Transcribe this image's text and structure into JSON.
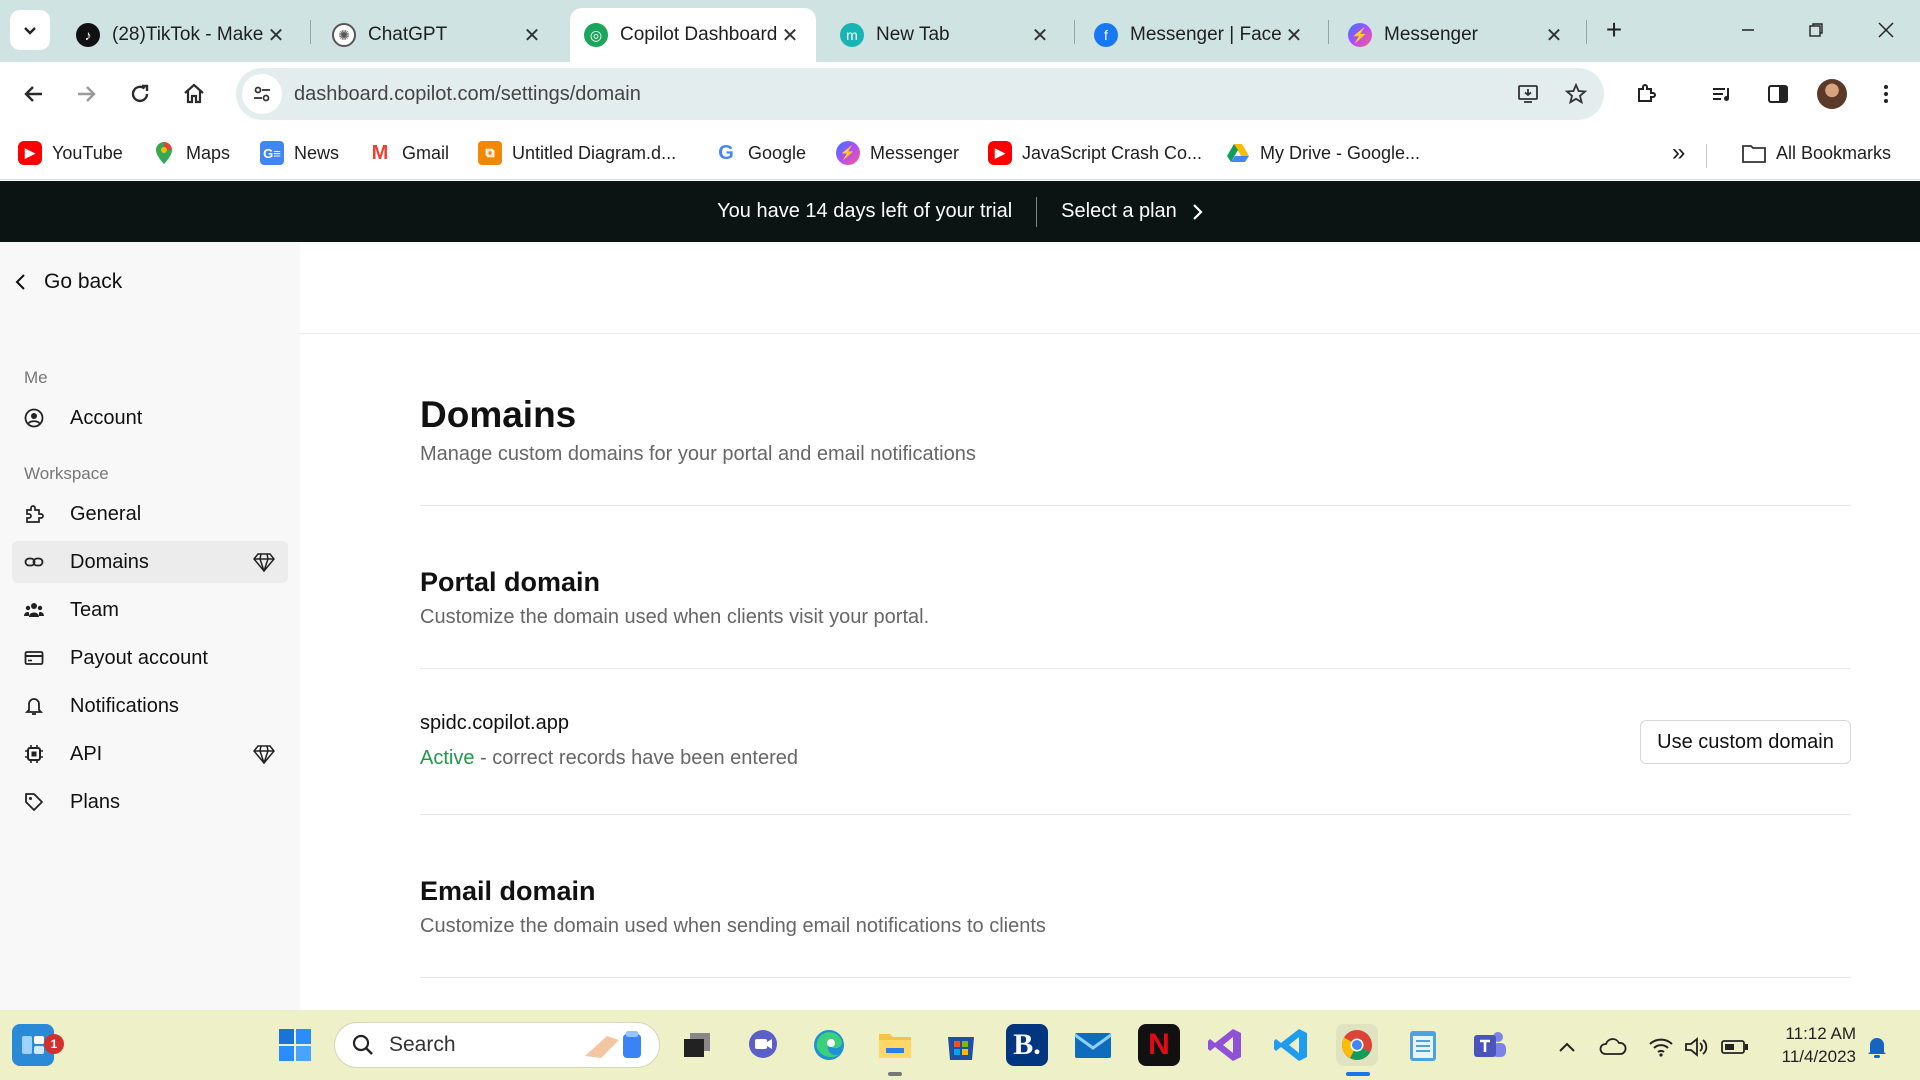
{
  "browser": {
    "tabs": [
      {
        "title": "(28)TikTok - Make"
      },
      {
        "title": "ChatGPT"
      },
      {
        "title": "Copilot Dashboard"
      },
      {
        "title": "New Tab"
      },
      {
        "title": "Messenger | Faceb"
      },
      {
        "title": "Messenger"
      }
    ],
    "close_glyph": "✕",
    "new_tab_glyph": "+",
    "url": "dashboard.copilot.com/settings/domain",
    "bookmarks": [
      {
        "label": "YouTube"
      },
      {
        "label": "Maps"
      },
      {
        "label": "News"
      },
      {
        "label": "Gmail"
      },
      {
        "label": "Untitled Diagram.d..."
      },
      {
        "label": "Google"
      },
      {
        "label": "Messenger"
      },
      {
        "label": "JavaScript Crash Co..."
      },
      {
        "label": "My Drive - Google..."
      }
    ],
    "more_bookmarks": "»",
    "all_bookmarks": "All Bookmarks"
  },
  "banner": {
    "trial_text": "You have 14 days left of your trial",
    "plan_link": "Select a plan"
  },
  "sidebar": {
    "go_back": "Go back",
    "me_section": "Me",
    "workspace_section": "Workspace",
    "items": [
      {
        "label": "Account",
        "icon": "user-circle-icon"
      },
      {
        "label": "General",
        "icon": "puzzle-icon"
      },
      {
        "label": "Domains",
        "icon": "link-icon",
        "premium": true,
        "active": true
      },
      {
        "label": "Team",
        "icon": "team-icon"
      },
      {
        "label": "Payout account",
        "icon": "card-icon"
      },
      {
        "label": "Notifications",
        "icon": "bell-icon"
      },
      {
        "label": "API",
        "icon": "chip-icon",
        "premium": true
      },
      {
        "label": "Plans",
        "icon": "tag-icon"
      }
    ]
  },
  "main": {
    "title": "Domains",
    "subtitle": "Manage custom domains for your portal and email notifications",
    "portal": {
      "title": "Portal domain",
      "description": "Customize the domain used when clients visit your portal.",
      "domain": "spidc.copilot.app",
      "status": "Active",
      "status_detail": " - correct records have been entered",
      "button": "Use custom domain"
    },
    "email": {
      "title": "Email domain",
      "description": "Customize the domain used when sending email notifications to clients"
    }
  },
  "taskbar": {
    "search_placeholder": "Search",
    "widgets_badge": "1",
    "time": "11:12 AM",
    "date": "11/4/2023"
  },
  "colors": {
    "accent_green": "#1f9b47",
    "banner_bg": "#0c1413",
    "tabbar_bg": "#cfe3e3",
    "taskbar_bg": "#eef0c8"
  }
}
